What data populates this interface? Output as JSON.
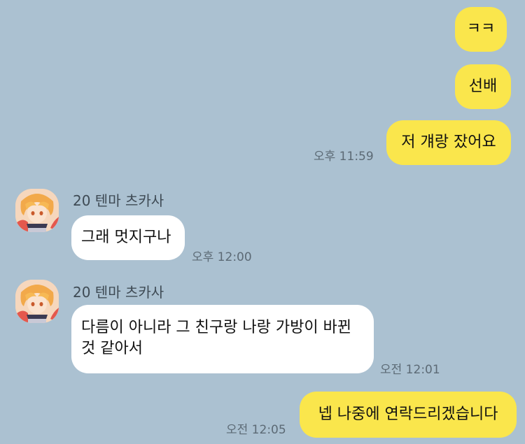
{
  "chat": {
    "messages": [
      {
        "side": "me",
        "text": "ㅋㅋ"
      },
      {
        "side": "me",
        "text": "선배"
      },
      {
        "side": "me",
        "text": "저 걔랑 잤어요",
        "time": "오후 11:59"
      },
      {
        "side": "them",
        "sender": "20 텐마 츠카사",
        "text": "그래 멋지구나",
        "time": "오후 12:00"
      },
      {
        "side": "them",
        "sender": "20 텐마 츠카사",
        "text_lines": [
          "다름이 아니라 그 친구랑 나랑 가방이 바뀐",
          "것 같아서"
        ],
        "time": "오전 12:01"
      },
      {
        "side": "me",
        "text": "넵 나중에 연락드리겠습니다",
        "time": "오전 12:05"
      }
    ]
  },
  "colors": {
    "background": "#abc1d1",
    "my_bubble": "#fae64c",
    "their_bubble": "#ffffff",
    "timestamp": "#5c6a75"
  },
  "icons": {
    "avatar": "profile-avatar-icon"
  }
}
